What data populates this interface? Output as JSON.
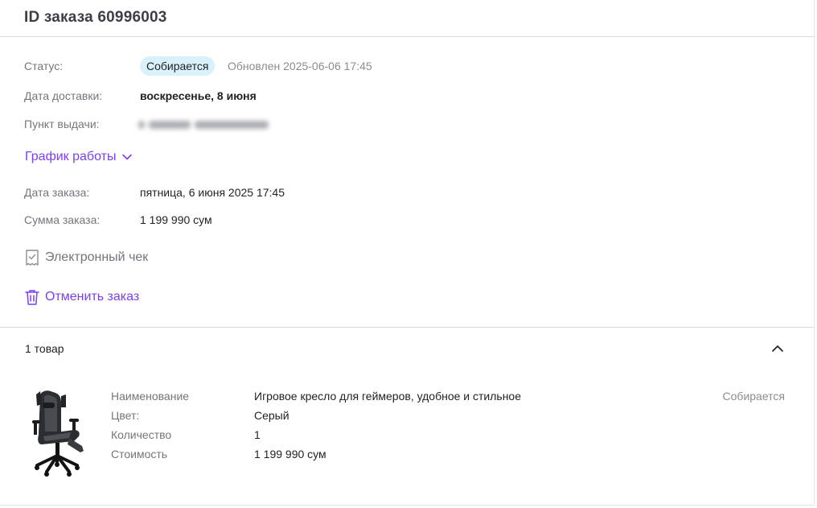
{
  "header": {
    "title": "ID заказа 60996003"
  },
  "details": {
    "status_label": "Статус:",
    "status_badge": "Собирается",
    "updated_text": "Обновлен 2025-06-06 17:45",
    "delivery_label": "Дата доставки:",
    "delivery_value": "воскресенье, 8 июня",
    "pickup_label": "Пункт выдачи:",
    "schedule_link": "График работы",
    "order_date_label": "Дата заказа:",
    "order_date_value": "пятница, 6 июня 2025 17:45",
    "sum_label": "Сумма заказа:",
    "sum_value": "1 199 990 сум"
  },
  "actions": {
    "receipt_label": "Электронный чек",
    "cancel_label": "Отменить заказ"
  },
  "items_section": {
    "count_label": "1 товар",
    "product": {
      "name_label": "Наименование",
      "name_value": "Игровое кресло для геймеров, удобное и стильное",
      "color_label": "Цвет:",
      "color_value": "Серый",
      "qty_label": "Количество",
      "qty_value": "1",
      "price_label": "Стоимость",
      "price_value": "1 199 990 сум",
      "status": "Собирается"
    }
  },
  "colors": {
    "accent": "#7b3ff2",
    "badge_bg": "#d8f1fb",
    "muted_text": "#74767d",
    "divider": "#dcdce0"
  },
  "icons": {
    "schedule_toggle": "chevron-down-icon",
    "receipt": "receipt-icon",
    "cancel": "trash-icon",
    "items_toggle": "chevron-up-icon"
  }
}
